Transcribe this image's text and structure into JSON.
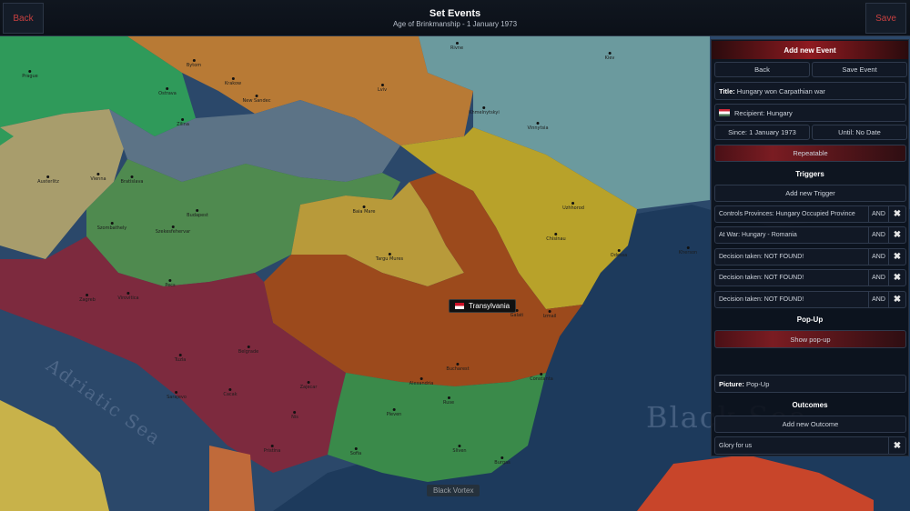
{
  "topbar": {
    "back": "Back",
    "save": "Save",
    "title": "Set Events",
    "subtitle": "Age of Brinkmanship - 1 January 1973"
  },
  "panel": {
    "header": "Add new Event",
    "back": "Back",
    "save_event": "Save Event",
    "title_label": "Title:",
    "title_value": "Hungary won Carpathian war",
    "recipient": "Recipient: Hungary",
    "since": "Since: 1 January 1973",
    "until": "Until: No Date",
    "repeatable": "Repeatable",
    "triggers_header": "Triggers",
    "add_trigger": "Add new Trigger",
    "triggers": [
      {
        "text": "Controls Provinces: Hungary Occupied Province",
        "op": "AND"
      },
      {
        "text": "At War: Hungary - Romania",
        "op": "AND"
      },
      {
        "text": "Decision taken: NOT FOUND!",
        "op": "AND"
      },
      {
        "text": "Decision taken: NOT FOUND!",
        "op": "AND"
      },
      {
        "text": "Decision taken: NOT FOUND!",
        "op": "AND"
      }
    ],
    "popup_header": "Pop-Up",
    "show_popup": "Show pop-up",
    "picture_label": "Picture:",
    "picture_value": "Pop-Up",
    "outcomes_header": "Outcomes",
    "add_outcome": "Add new Outcome",
    "outcome": "Glory for us",
    "remove_glyph": "✖"
  },
  "map": {
    "tooltip": "Transylvania",
    "vortex": "Black Vortex",
    "seas": [
      "Adriatic Sea",
      "Black Sea"
    ],
    "cities": [
      "Wroclaw",
      "Lublin",
      "Rivne",
      "Kiev",
      "Prague",
      "Bytom",
      "Krakow",
      "Ostrava",
      "New Sandec",
      "Lviv",
      "Khmelnytskyi",
      "Vinnytsia",
      "Zilina",
      "Austerlitz",
      "Vienna",
      "Bratislava",
      "Budapest",
      "Baia Mare",
      "Uzhhorod",
      "Szombathely",
      "Szekesfehervar",
      "Chisinau",
      "Odessa",
      "Kherson",
      "Targu Mures",
      "Pecs",
      "Zagreb",
      "Virovitica",
      "Galati",
      "Izmail",
      "Belgrade",
      "Tuzla",
      "Bucharest",
      "Constanta",
      "Alexandria",
      "Sarajevo",
      "Cacak",
      "Zajecar",
      "Ruse",
      "Nis",
      "Pleven",
      "Pristina",
      "Sofia",
      "Sliven",
      "Burgas"
    ]
  }
}
